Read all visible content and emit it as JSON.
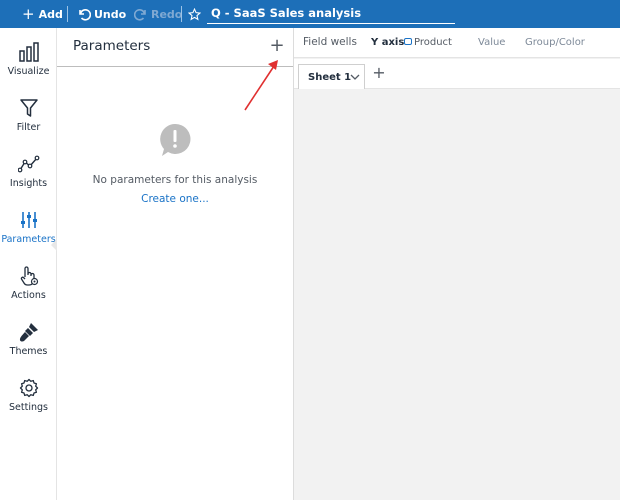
{
  "toolbar": {
    "add_label": "Add",
    "undo_label": "Undo",
    "redo_label": "Redo",
    "analysis_title": "Q - SaaS Sales analysis",
    "background_color": "#1d6fb8"
  },
  "rail": {
    "items": [
      {
        "label": "Visualize",
        "icon": "visualize-icon"
      },
      {
        "label": "Filter",
        "icon": "filter-icon"
      },
      {
        "label": "Insights",
        "icon": "insights-icon"
      },
      {
        "label": "Parameters",
        "icon": "parameters-icon",
        "active": true
      },
      {
        "label": "Actions",
        "icon": "actions-icon"
      },
      {
        "label": "Themes",
        "icon": "themes-icon"
      },
      {
        "label": "Settings",
        "icon": "settings-icon"
      }
    ],
    "active_color": "#1a73c7"
  },
  "panel": {
    "title": "Parameters",
    "add_symbol": "+",
    "empty_message": "No parameters for this analysis",
    "create_link": "Create one..."
  },
  "field_wells": {
    "label": "Field wells",
    "y_axis_label": "Y axis",
    "y_axis_value": "Product",
    "value_label": "Value",
    "group_label": "Group/Color"
  },
  "sheets": {
    "tabs": [
      {
        "label": "Sheet 1"
      }
    ],
    "add_symbol": "+"
  },
  "annotation": {
    "color": "#e03030"
  }
}
